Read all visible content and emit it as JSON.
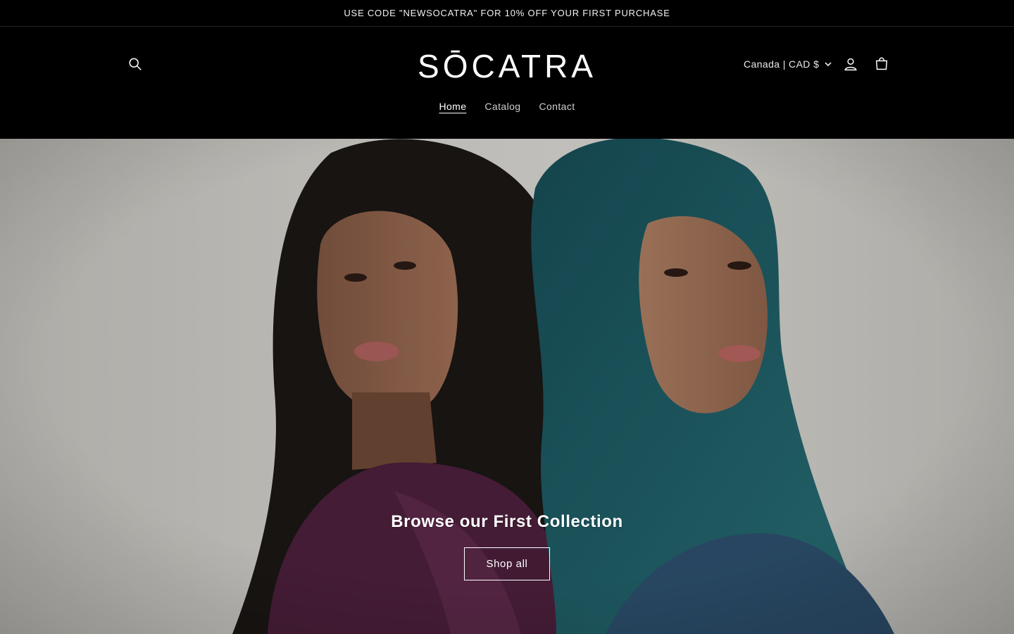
{
  "announcement": {
    "text": "USE CODE \"NEWSOCATRA\" FOR 10% OFF YOUR FIRST PURCHASE"
  },
  "header": {
    "logo_text": "SŌCATRA",
    "country_selector": "Canada | CAD $",
    "icons": {
      "search": "search-icon",
      "account": "account-icon",
      "cart": "cart-icon",
      "chevron": "chevron-down-icon"
    }
  },
  "nav": {
    "items": [
      {
        "label": "Home",
        "active": true
      },
      {
        "label": "Catalog",
        "active": false
      },
      {
        "label": "Contact",
        "active": false
      }
    ]
  },
  "hero": {
    "title": "Browse our First Collection",
    "button_label": "Shop all"
  },
  "colors": {
    "header_bg": "#000000",
    "text": "#ffffff",
    "hero_bg": "#cac8c3",
    "hijab": "#1f5a63",
    "robe_left": "#4a1f3a"
  }
}
